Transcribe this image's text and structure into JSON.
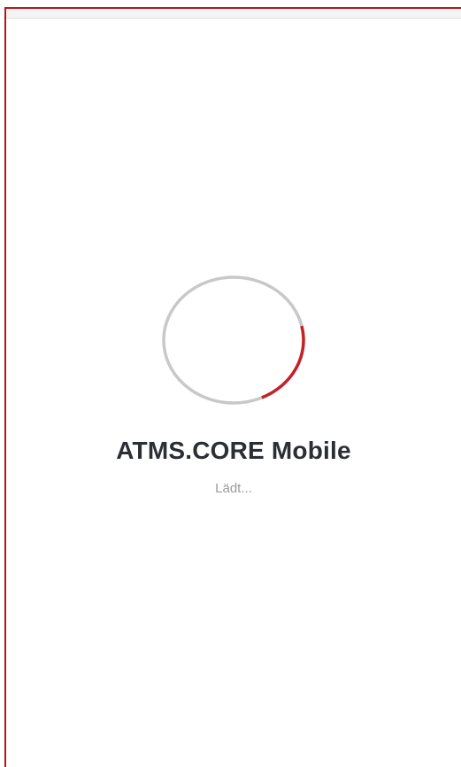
{
  "app": {
    "title": "ATMS.CORE Mobile",
    "status": "Lädt..."
  },
  "spinner": {
    "icon": "loading-spinner-icon",
    "progress_fraction": 0.22
  },
  "colors": {
    "accent": "#c42127",
    "track": "#c8c8c8",
    "frame_border": "#b01a1a",
    "title": "#2b2f33",
    "status": "#9a9a9a"
  }
}
